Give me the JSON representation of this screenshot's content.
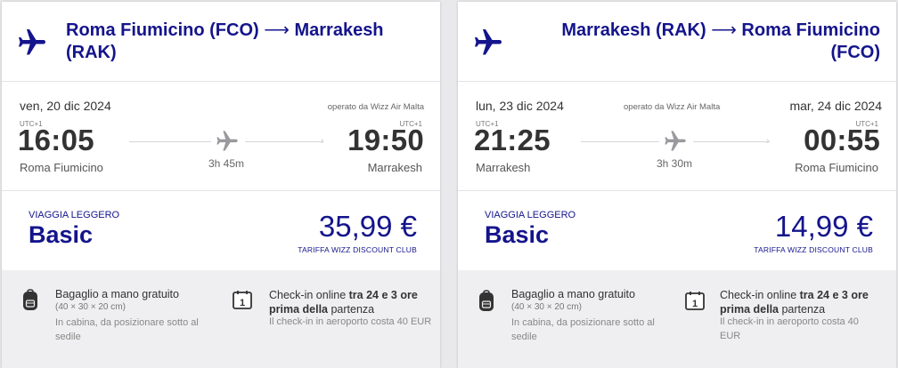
{
  "flights": [
    {
      "route_from": "Roma Fiumicino (FCO)",
      "route_arrow": "⟶",
      "route_to": "Marrakesh (RAK)",
      "departure_date": "ven, 20 dic 2024",
      "arrival_date": "",
      "operated_by": "operato da Wizz Air Malta",
      "departure_utc": "UTC+1",
      "arrival_utc": "UTC+1",
      "departure_time": "16:05",
      "arrival_time": "19:50",
      "departure_city": "Roma Fiumicino",
      "arrival_city": "Marrakesh",
      "duration": "3h 45m",
      "fare_tag": "VIAGGIA LEGGERO",
      "fare_name": "Basic",
      "price": "35,99 €",
      "club_label": "TARIFFA WIZZ DISCOUNT CLUB",
      "bag_title": "Bagaglio a mano gratuito",
      "bag_dimensions": "(40 × 30 × 20 cm)",
      "bag_note": "In cabina, da posizionare sotto al sedile",
      "checkin_prefix": "Check-in online ",
      "checkin_bold_1": "tra 24 e 3 ore prima della",
      "checkin_suffix": " partenza",
      "checkin_note": "Il check-in in aeroporto costa 40 EUR"
    },
    {
      "route_from": "Marrakesh (RAK)",
      "route_arrow": "⟶",
      "route_to": "Roma Fiumicino (FCO)",
      "departure_date": "lun, 23 dic 2024",
      "arrival_date": "mar, 24 dic 2024",
      "operated_by": "operato da Wizz Air Malta",
      "departure_utc": "UTC+1",
      "arrival_utc": "UTC+1",
      "departure_time": "21:25",
      "arrival_time": "00:55",
      "departure_city": "Marrakesh",
      "arrival_city": "Roma Fiumicino",
      "duration": "3h 30m",
      "fare_tag": "VIAGGIA LEGGERO",
      "fare_name": "Basic",
      "price": "14,99 €",
      "club_label": "TARIFFA WIZZ DISCOUNT CLUB",
      "bag_title": "Bagaglio a mano gratuito",
      "bag_dimensions": "(40 × 30 × 20 cm)",
      "bag_note": "In cabina, da posizionare sotto al sedile",
      "checkin_prefix": "Check-in online ",
      "checkin_bold_1": "tra 24 e 3 ore prima della",
      "checkin_suffix": " partenza",
      "checkin_note": "Il check-in in aeroporto costa 40 EUR"
    }
  ],
  "icons": {
    "header_plane": "airplane-icon",
    "mid_plane": "airplane-icon",
    "baggage": "backpack-icon",
    "calendar": "calendar-icon",
    "calendar_day": "1"
  },
  "colors": {
    "brand": "#14148c",
    "text": "#333333",
    "muted": "#888888",
    "info_bg": "#efeff1"
  }
}
